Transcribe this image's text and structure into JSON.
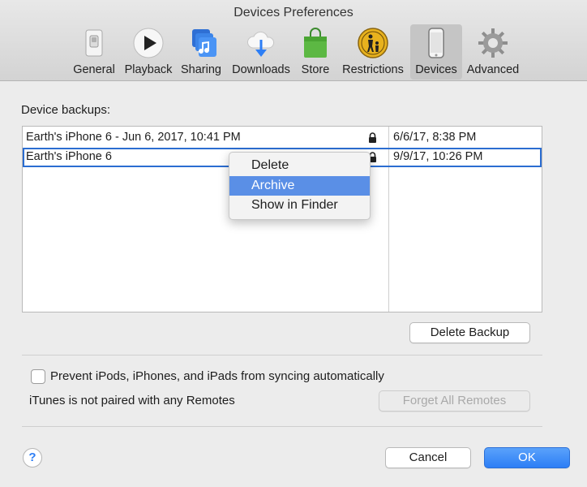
{
  "window": {
    "title": "Devices Preferences"
  },
  "tabs": [
    {
      "label": "General",
      "icon": "switch-icon"
    },
    {
      "label": "Playback",
      "icon": "play-icon"
    },
    {
      "label": "Sharing",
      "icon": "music-note-icon"
    },
    {
      "label": "Downloads",
      "icon": "cloud-download-icon"
    },
    {
      "label": "Store",
      "icon": "shopping-bag-icon"
    },
    {
      "label": "Restrictions",
      "icon": "parental-icon"
    },
    {
      "label": "Devices",
      "icon": "iphone-icon",
      "active": true
    },
    {
      "label": "Advanced",
      "icon": "gear-icon"
    }
  ],
  "backups": {
    "label": "Device backups:",
    "rows": [
      {
        "name": "Earth's iPhone 6 - Jun 6, 2017, 10:41 PM",
        "date": "6/6/17, 8:38 PM",
        "locked": true
      },
      {
        "name": "Earth's iPhone 6",
        "date": "9/9/17, 10:26 PM",
        "locked": true,
        "selected": true
      }
    ],
    "delete_button": "Delete Backup"
  },
  "context_menu": {
    "items": [
      "Delete",
      "Archive",
      "Show in Finder"
    ],
    "highlighted": "Archive"
  },
  "options": {
    "prevent_sync_label": "Prevent iPods, iPhones, and iPads from syncing automatically",
    "prevent_sync_checked": false,
    "remotes_text": "iTunes is not paired with any Remotes",
    "forget_remotes_button": "Forget All Remotes"
  },
  "footer": {
    "help": "?",
    "cancel": "Cancel",
    "ok": "OK"
  },
  "colors": {
    "accent": "#2d7ef5",
    "highlight": "#5a8fe6"
  }
}
